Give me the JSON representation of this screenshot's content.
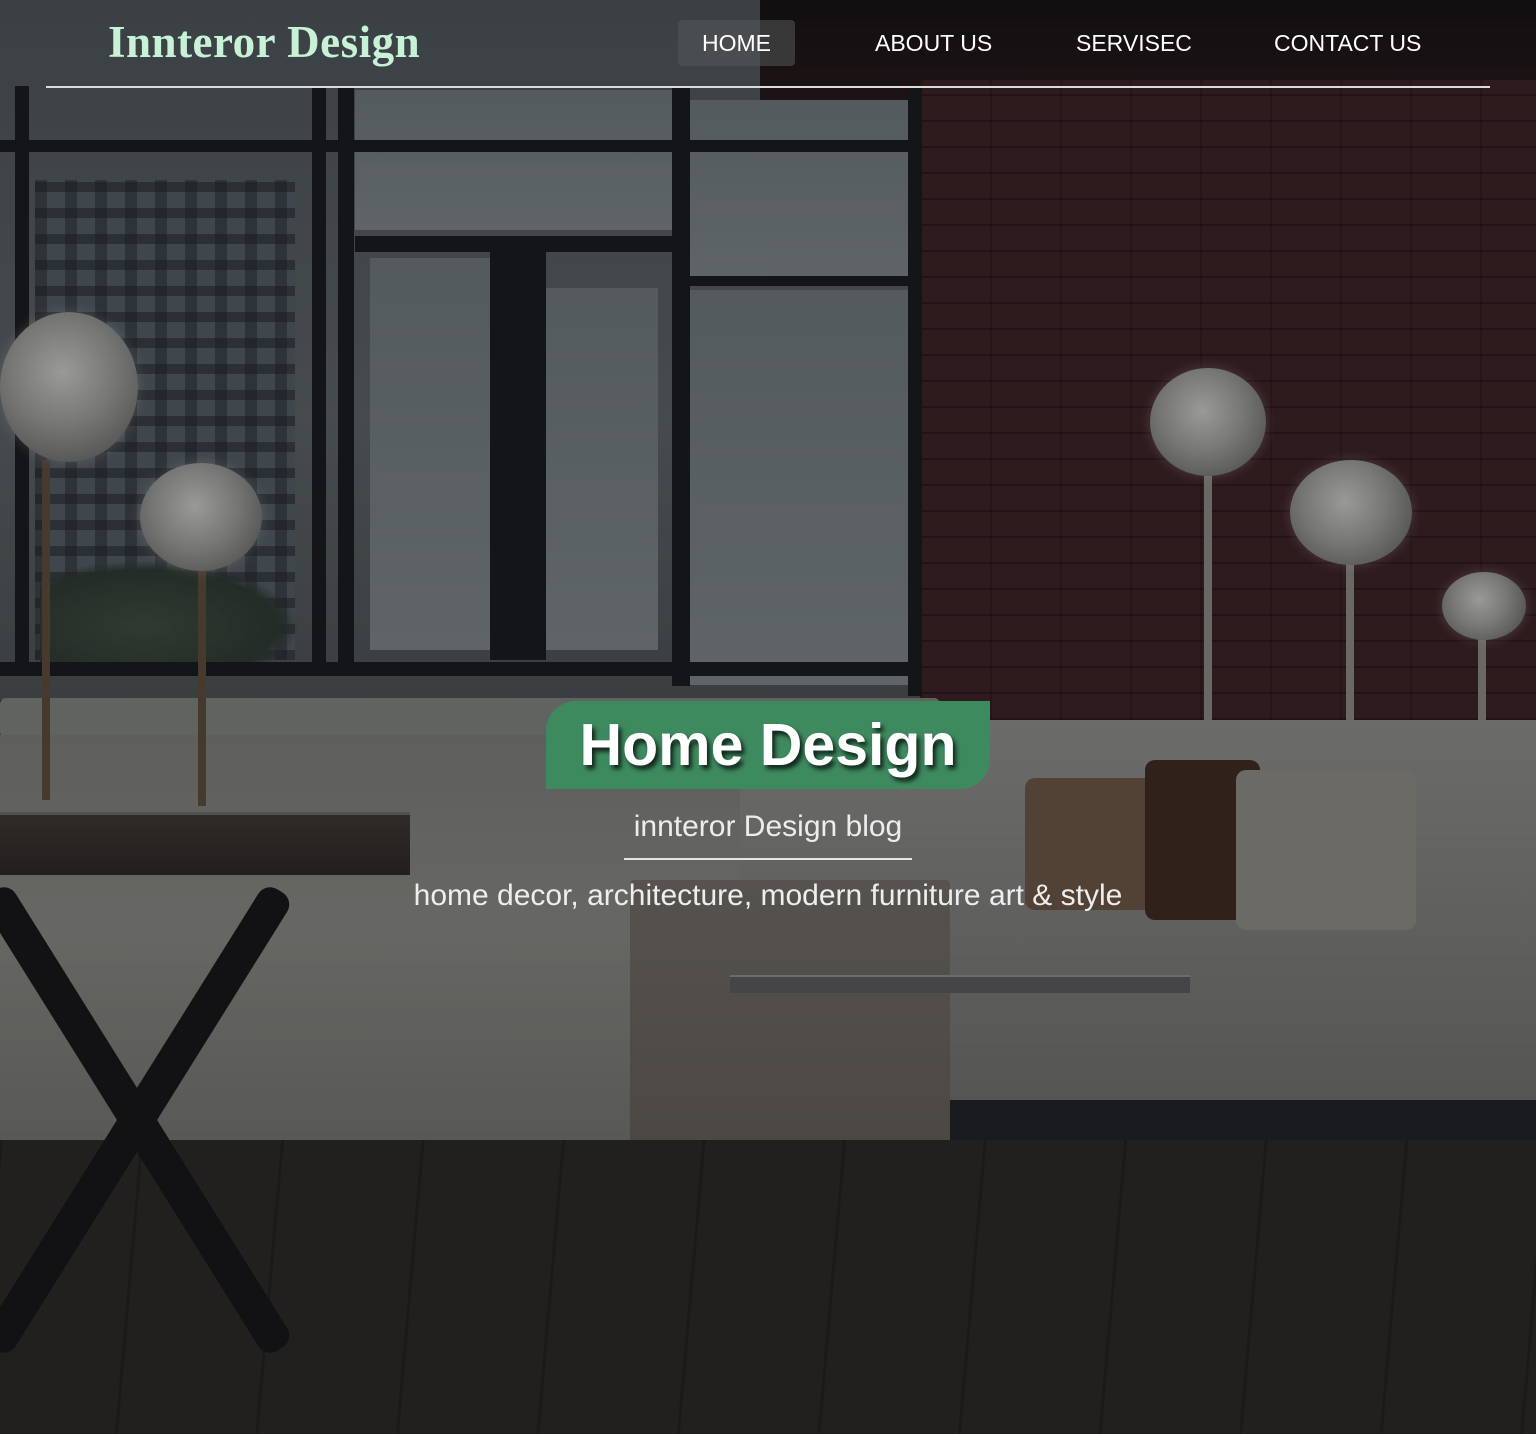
{
  "brand": {
    "logo_text": "Innteror Design",
    "logo_color": "#c8f2d6"
  },
  "nav": {
    "items": [
      {
        "label": "HOME",
        "active": true
      },
      {
        "label": "ABOUT US",
        "active": false
      },
      {
        "label": "SERVISEC",
        "active": false
      },
      {
        "label": "CONTACT US",
        "active": false
      }
    ]
  },
  "hero": {
    "title": "Home Design",
    "title_bg_color": "#3e8a5f",
    "subtitle": "innteror Design blog",
    "tagline": "home decor, architecture, modern furniture art & style"
  }
}
